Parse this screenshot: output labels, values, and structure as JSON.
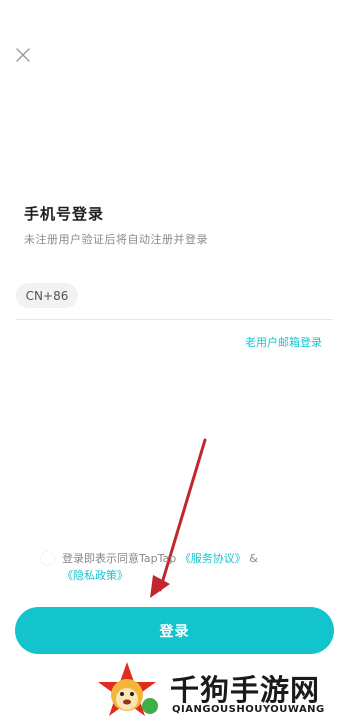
{
  "header": {
    "close_icon": "close-icon"
  },
  "login": {
    "title": "手机号登录",
    "subtitle": "未注册用户验证后将自动注册并登录",
    "country_code": "CN+86",
    "phone_value": "",
    "email_login_label": "老用户邮箱登录"
  },
  "agreement": {
    "prefix": "登录即表示同意TapTap ",
    "service_link": "《服务协议》",
    "connector": " & ",
    "privacy_link": "《隐私政策》"
  },
  "actions": {
    "login_label": "登录"
  },
  "watermark": {
    "title": "千狗手游网",
    "subtitle": "QIANGOUSHOUYOUWANG"
  },
  "colors": {
    "accent": "#14c4cc",
    "link": "#15c5ce",
    "annotation_arrow": "#c0262c"
  }
}
